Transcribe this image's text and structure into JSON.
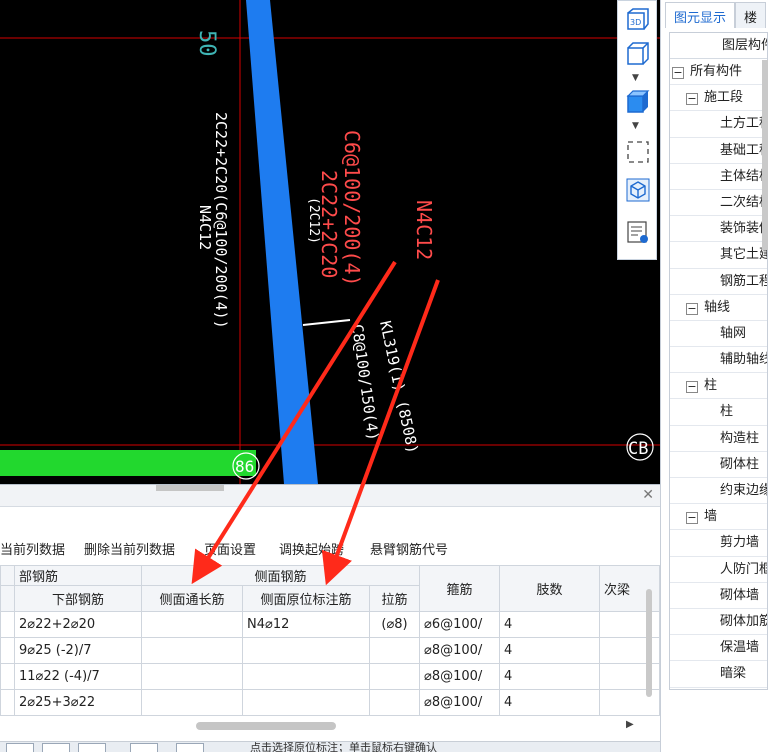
{
  "cad": {
    "labels": {
      "top_fragment": "50",
      "left_annot_1": "2C22+2C20(C6@100/200(4))",
      "left_annot_2": "N4C12",
      "red_annot_1": "2C22+2C20",
      "red_annot_2": "C6@100/200(4)",
      "red_annot_3": "N4C12",
      "small_annot": "(2C12)",
      "beam_label_1": "KL319(1) (8508)",
      "beam_label_2": "C8@100/150(4)",
      "node_label": "86",
      "axis_label": "CB"
    },
    "colors": {
      "background": "#000000",
      "grid_red": "#d40000",
      "beam_blue": "#1e7cf0",
      "beam_green": "#22d82e",
      "annot_red": "#ff4b4b",
      "annot_white": "#ffffff",
      "cyan": "#3fb5b5"
    }
  },
  "toolbar": {
    "items": [
      {
        "icon": "3d-view-icon",
        "label": "3D"
      },
      {
        "icon": "cube-outline-icon",
        "label": ""
      },
      {
        "icon": "cube-solid-icon",
        "label": ""
      },
      {
        "icon": "select-frame-icon",
        "label": ""
      },
      {
        "icon": "component-icon",
        "label": ""
      },
      {
        "icon": "layer-list-icon",
        "label": ""
      }
    ]
  },
  "right_panel": {
    "tabs": [
      "图元显示",
      "楼"
    ],
    "tree_header": "图层构件",
    "tree": [
      {
        "level": 0,
        "toggle": "−",
        "label": "所有构件"
      },
      {
        "level": 1,
        "toggle": "−",
        "label": "施工段"
      },
      {
        "level": 2,
        "label": "土方工程"
      },
      {
        "level": 2,
        "label": "基础工程"
      },
      {
        "level": 2,
        "label": "主体结构"
      },
      {
        "level": 2,
        "label": "二次结构"
      },
      {
        "level": 2,
        "label": "装饰装修"
      },
      {
        "level": 2,
        "label": "其它土建"
      },
      {
        "level": 2,
        "label": "钢筋工程"
      },
      {
        "level": 1,
        "toggle": "−",
        "label": "轴线"
      },
      {
        "level": 2,
        "label": "轴网"
      },
      {
        "level": 2,
        "label": "辅助轴线"
      },
      {
        "level": 1,
        "toggle": "−",
        "label": "柱"
      },
      {
        "level": 2,
        "label": "柱"
      },
      {
        "level": 2,
        "label": "构造柱"
      },
      {
        "level": 2,
        "label": "砌体柱"
      },
      {
        "level": 2,
        "label": "约束边缘"
      },
      {
        "level": 1,
        "toggle": "−",
        "label": "墙"
      },
      {
        "level": 2,
        "label": "剪力墙"
      },
      {
        "level": 2,
        "label": "人防门框"
      },
      {
        "level": 2,
        "label": "砌体墙"
      },
      {
        "level": 2,
        "label": "砌体加筋"
      },
      {
        "level": 2,
        "label": "保温墙"
      },
      {
        "level": 2,
        "label": "暗梁"
      }
    ]
  },
  "bottom_panel": {
    "toolbar": [
      "当前列数据",
      "删除当前列数据",
      "页面设置",
      "调换起始跨",
      "悬臂钢筋代号"
    ],
    "group_headers": {
      "bottom": "部钢筋",
      "side": "侧面钢筋"
    },
    "columns": [
      "下部钢筋",
      "侧面通长筋",
      "侧面原位标注筋",
      "拉筋",
      "箍筋",
      "肢数",
      "次梁"
    ],
    "rows": [
      {
        "bottom": "2⌀22+2⌀20",
        "side_through": "",
        "side_in_situ": "N4⌀12",
        "tie": "(⌀8)",
        "stirrup": "⌀6@100/",
        "legs": "4"
      },
      {
        "bottom": "9⌀25 (-2)/7",
        "side_through": "",
        "side_in_situ": "",
        "tie": "",
        "stirrup": "⌀8@100/",
        "legs": "4"
      },
      {
        "bottom": "11⌀22 (-4)/7",
        "side_through": "",
        "side_in_situ": "",
        "tie": "",
        "stirrup": "⌀8@100/",
        "legs": "4"
      },
      {
        "bottom": "2⌀25+3⌀22",
        "side_through": "",
        "side_in_situ": "",
        "tie": "",
        "stirrup": "⌀8@100/",
        "legs": "4"
      }
    ]
  },
  "status_text": "点击选择原位标注；单击鼠标右键确认"
}
